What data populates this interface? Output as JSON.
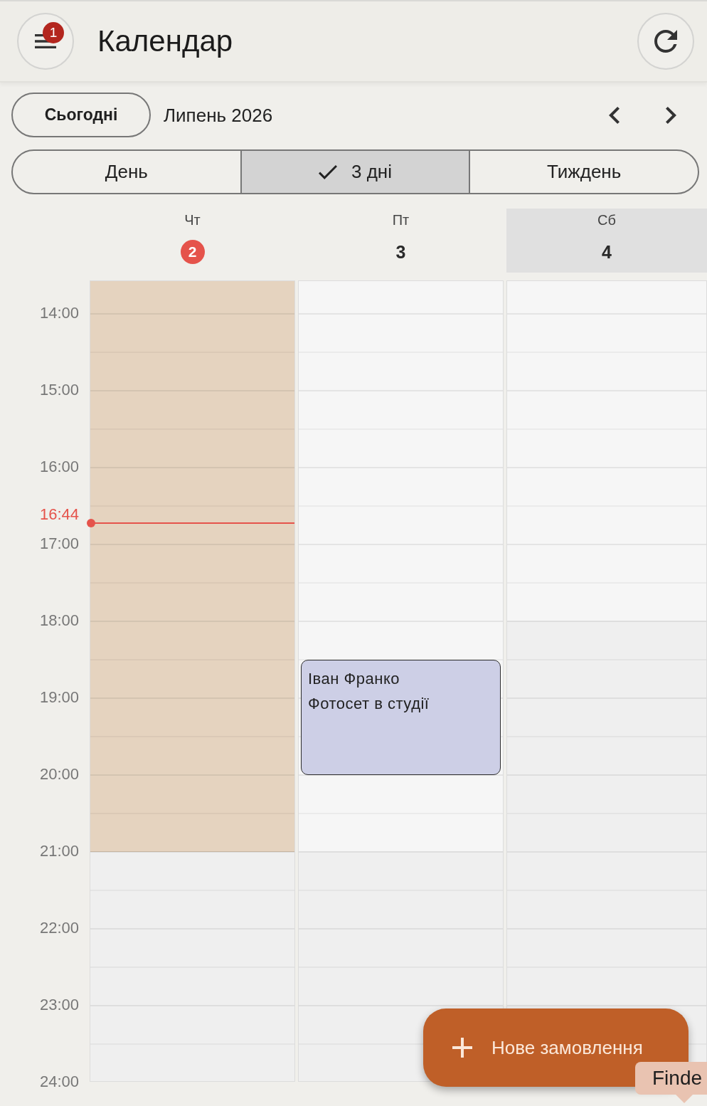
{
  "app_bar": {
    "title": "Календар",
    "badge": "1"
  },
  "toolbar": {
    "today_button": "Сьогодні",
    "month": "Липень 2026"
  },
  "view_modes": [
    {
      "label": "День",
      "selected": false
    },
    {
      "label": "3 дні",
      "selected": true
    },
    {
      "label": "Тиждень",
      "selected": false
    }
  ],
  "days": [
    {
      "weekday": "Чт",
      "date": "2",
      "today": true,
      "weekend": false
    },
    {
      "weekday": "Пт",
      "date": "3",
      "today": false,
      "weekend": false,
      "events": [
        {
          "client": "Іван Франко",
          "description": "Фотосет в студії"
        }
      ]
    },
    {
      "weekday": "Сб",
      "date": "4",
      "today": false,
      "weekend": true
    }
  ],
  "time_labels": [
    "14:00",
    "15:00",
    "16:00",
    "17:00",
    "18:00",
    "19:00",
    "20:00",
    "21:00",
    "22:00",
    "23:00",
    "24:00"
  ],
  "current_time": {
    "label": "16:44"
  },
  "fab": {
    "label": "Нове замовлення"
  },
  "tooltip": {
    "label": "Finde"
  }
}
